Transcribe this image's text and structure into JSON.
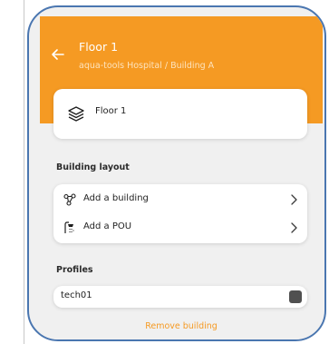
{
  "header": {
    "title": "Floor 1",
    "subtitle": "aqua-tools Hospital / Building A"
  },
  "floor_card": {
    "label": "Floor 1",
    "icon": "layers-icon"
  },
  "building_layout": {
    "section_title": "Building layout",
    "items": [
      {
        "label": "Add a building",
        "icon": "graph-nodes-icon"
      },
      {
        "label": "Add a POU",
        "icon": "shower-icon"
      }
    ]
  },
  "profiles": {
    "section_title": "Profiles",
    "items": [
      {
        "label": "tech01"
      }
    ]
  },
  "footer": {
    "remove_label": "Remove building"
  },
  "colors": {
    "accent": "#f59a23",
    "frame": "#4a76b0",
    "swatch": "#505050"
  }
}
